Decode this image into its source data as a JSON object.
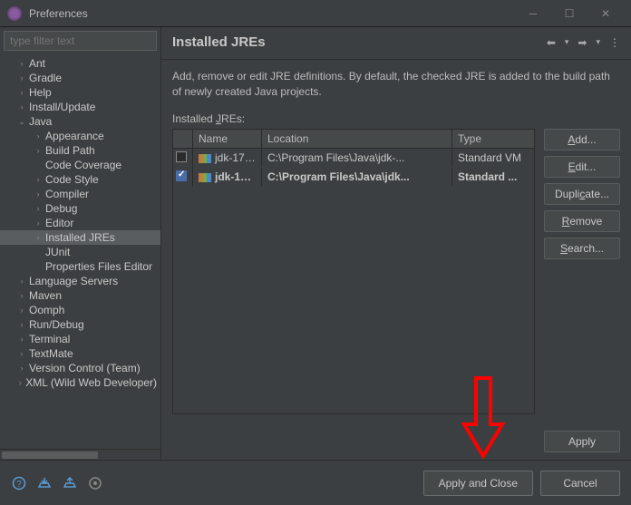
{
  "titlebar": {
    "title": "Preferences"
  },
  "sidebar": {
    "filter_placeholder": "type filter text",
    "items": [
      {
        "label": "Ant",
        "expandable": true,
        "level": 1
      },
      {
        "label": "Gradle",
        "expandable": true,
        "level": 1
      },
      {
        "label": "Help",
        "expandable": true,
        "level": 1
      },
      {
        "label": "Install/Update",
        "expandable": true,
        "level": 1
      },
      {
        "label": "Java",
        "expandable": true,
        "level": 1,
        "expanded": true
      },
      {
        "label": "Appearance",
        "expandable": true,
        "level": 2
      },
      {
        "label": "Build Path",
        "expandable": true,
        "level": 2
      },
      {
        "label": "Code Coverage",
        "expandable": false,
        "level": 2
      },
      {
        "label": "Code Style",
        "expandable": true,
        "level": 2
      },
      {
        "label": "Compiler",
        "expandable": true,
        "level": 2
      },
      {
        "label": "Debug",
        "expandable": true,
        "level": 2
      },
      {
        "label": "Editor",
        "expandable": true,
        "level": 2
      },
      {
        "label": "Installed JREs",
        "expandable": true,
        "level": 2,
        "selected": true
      },
      {
        "label": "JUnit",
        "expandable": false,
        "level": 2
      },
      {
        "label": "Properties Files Editor",
        "expandable": false,
        "level": 2
      },
      {
        "label": "Language Servers",
        "expandable": true,
        "level": 1
      },
      {
        "label": "Maven",
        "expandable": true,
        "level": 1
      },
      {
        "label": "Oomph",
        "expandable": true,
        "level": 1
      },
      {
        "label": "Run/Debug",
        "expandable": true,
        "level": 1
      },
      {
        "label": "Terminal",
        "expandable": true,
        "level": 1
      },
      {
        "label": "TextMate",
        "expandable": true,
        "level": 1
      },
      {
        "label": "Version Control (Team)",
        "expandable": true,
        "level": 1
      },
      {
        "label": "XML (Wild Web Developer)",
        "expandable": true,
        "level": 1
      }
    ]
  },
  "content": {
    "title": "Installed JREs",
    "description": "Add, remove or edit JRE definitions. By default, the checked JRE is added to the build path of newly created Java projects.",
    "section_label_prefix": "Installed ",
    "section_label_underlined": "J",
    "section_label_suffix": "REs:",
    "columns": {
      "name": "Name",
      "location": "Location",
      "type": "Type"
    },
    "rows": [
      {
        "checked": false,
        "name": "jdk-17....",
        "location": "C:\\Program Files\\Java\\jdk-...",
        "type": "Standard VM",
        "bold": false
      },
      {
        "checked": true,
        "name": "jdk-19 ...",
        "location": "C:\\Program Files\\Java\\jdk...",
        "type": "Standard ...",
        "bold": true
      }
    ],
    "buttons": {
      "add": "Add...",
      "edit": "Edit...",
      "duplicate": "Duplicate...",
      "remove": "Remove",
      "search": "Search..."
    },
    "apply": "Apply"
  },
  "footer": {
    "apply_close": "Apply and Close",
    "cancel": "Cancel"
  }
}
